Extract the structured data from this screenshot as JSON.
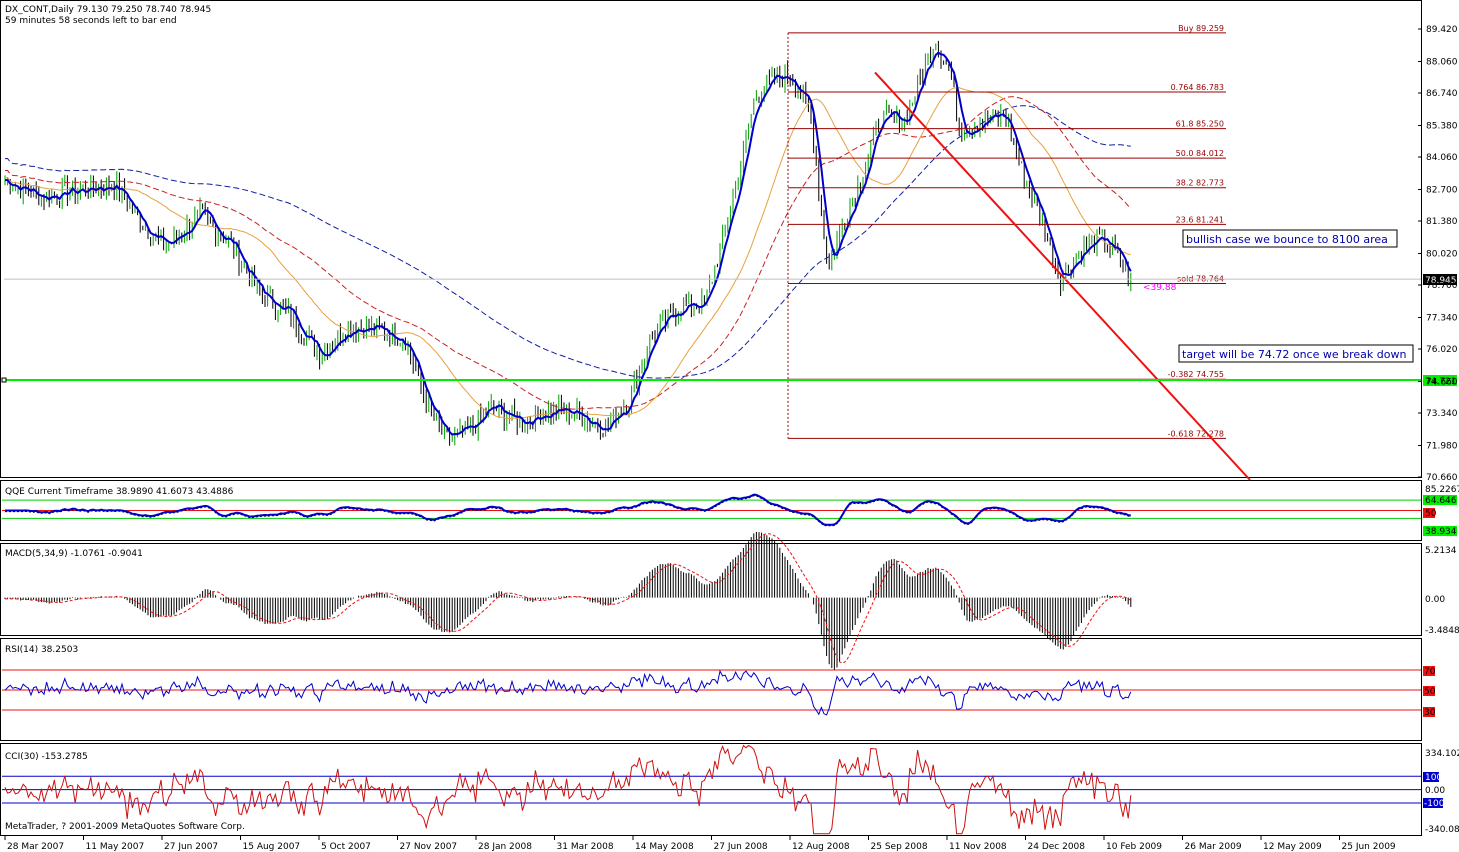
{
  "colors": {
    "background": "#ffffff",
    "frame": "#000000",
    "grid": "#c0c0c0",
    "candle": "#000000",
    "candle_up": "#00a000",
    "ma_fast": "#0000cc",
    "ma_orange": "#e8a040",
    "ma_red": "#cc2020",
    "ma_blue_slow": "#1020a0",
    "fib": "#990000",
    "trendline": "#ee1111",
    "support_line": "#00ee00",
    "label_bg_black": "#000000",
    "label_bg_green": "#00ee00",
    "label_bg_red": "#ee1111",
    "label_bg_blue": "#0000cc",
    "magenta": "#ff00ff"
  },
  "main": {
    "header_line1": "DX_CONT,Daily  79.130 79.250 78.740 78.945",
    "header_line2": "59 minutes 58 seconds left to bar end",
    "price_axis": [
      "89.420",
      "88.060",
      "86.740",
      "85.380",
      "84.060",
      "82.700",
      "81.380",
      "80.020",
      "78.700",
      "77.340",
      "76.020",
      "74.660",
      "73.340",
      "71.980",
      "70.660"
    ],
    "current_price_label": "78.945",
    "support_label": "74.721",
    "magenta_label": "<39.88",
    "fib_levels": [
      {
        "label": "Buy 89.259",
        "price": 89.259
      },
      {
        "label": "0.764 86.783",
        "price": 86.783
      },
      {
        "label": "61.8 85.250",
        "price": 85.25
      },
      {
        "label": "50.0 84.012",
        "price": 84.012
      },
      {
        "label": "38.2 82.773",
        "price": 82.773
      },
      {
        "label": "23.6 81.241",
        "price": 81.241
      },
      {
        "label": "sold 78.764",
        "price": 78.764
      },
      {
        "label": "-0.382 74.755",
        "price": 74.755
      },
      {
        "label": "-0.618 72.278",
        "price": 72.278
      }
    ],
    "annotation_bullish": "bullish case we bounce to 8100 area",
    "annotation_target": "target will be 74.72 once we break down"
  },
  "qqe": {
    "title": "QQE Current Timeframe 38.9890 41.6073 43.4886",
    "axis": [
      "85.2267"
    ],
    "labels": [
      {
        "text": "64.646",
        "type": "green"
      },
      {
        "text": "50",
        "type": "red"
      },
      {
        "text": "38.934",
        "type": "green"
      }
    ]
  },
  "macd": {
    "title": "MACD(5,34,9) -1.0761 -0.9041",
    "axis": [
      "5.2134",
      "0.00",
      "-3.4848"
    ]
  },
  "rsi": {
    "title": "RSI(14) 38.2503",
    "labels": [
      "70",
      "50",
      "30"
    ]
  },
  "cci": {
    "title": "CCI(30) -153.2785",
    "axis_top": "334.102",
    "axis_bottom": "-340.085",
    "labels": [
      "100",
      "0.00",
      "-100"
    ],
    "copyright": "MetaTrader, ? 2001-2009 MetaQuotes Software Corp."
  },
  "time_axis": [
    "28 Mar 2007",
    "11 May 2007",
    "27 Jun 2007",
    "15 Aug 2007",
    "5 Oct 2007",
    "27 Nov 2007",
    "28 Jan 2008",
    "31 Mar 2008",
    "14 May 2008",
    "27 Jun 2008",
    "12 Aug 2008",
    "25 Sep 2008",
    "11 Nov 2008",
    "24 Dec 2008",
    "10 Feb 2009",
    "26 Mar 2009",
    "12 May 2009",
    "25 Jun 2009"
  ]
}
